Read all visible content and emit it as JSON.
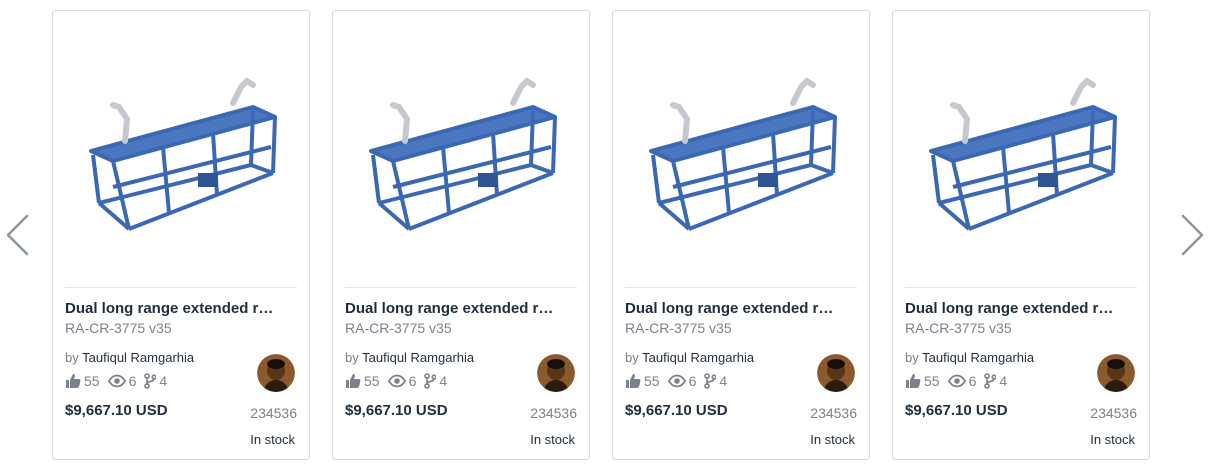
{
  "navigation": {
    "prev_icon": "chevron-left-icon",
    "next_icon": "chevron-right-icon",
    "arrow_color": "#8c969e"
  },
  "products": [
    {
      "title": "Dual long range extended r…",
      "part_number": "RA-CR-3775 v35",
      "by_label": "by",
      "author": "Taufiqul Ramgarhia",
      "likes": "55",
      "views": "6",
      "forks": "4",
      "price": "$9,667.10 USD",
      "code": "234536",
      "stock": "In stock"
    },
    {
      "title": "Dual long range extended r…",
      "part_number": "RA-CR-3775 v35",
      "by_label": "by",
      "author": "Taufiqul Ramgarhia",
      "likes": "55",
      "views": "6",
      "forks": "4",
      "price": "$9,667.10 USD",
      "code": "234536",
      "stock": "In stock"
    },
    {
      "title": "Dual long range extended r…",
      "part_number": "RA-CR-3775 v35",
      "by_label": "by",
      "author": "Taufiqul Ramgarhia",
      "likes": "55",
      "views": "6",
      "forks": "4",
      "price": "$9,667.10 USD",
      "code": "234536",
      "stock": "In stock"
    },
    {
      "title": "Dual long range extended r…",
      "part_number": "RA-CR-3775 v35",
      "by_label": "by",
      "author": "Taufiqul Ramgarhia",
      "likes": "55",
      "views": "6",
      "forks": "4",
      "price": "$9,667.10 USD",
      "code": "234536",
      "stock": "In stock"
    }
  ],
  "icons": {
    "likes": "thumbs-up-icon",
    "views": "eye-icon",
    "forks": "fork-icon"
  },
  "colors": {
    "frame_blue": "#3b68b3",
    "text_dark": "#1f2d3d",
    "text_muted": "#7a828b",
    "card_border": "#d9dde2"
  }
}
